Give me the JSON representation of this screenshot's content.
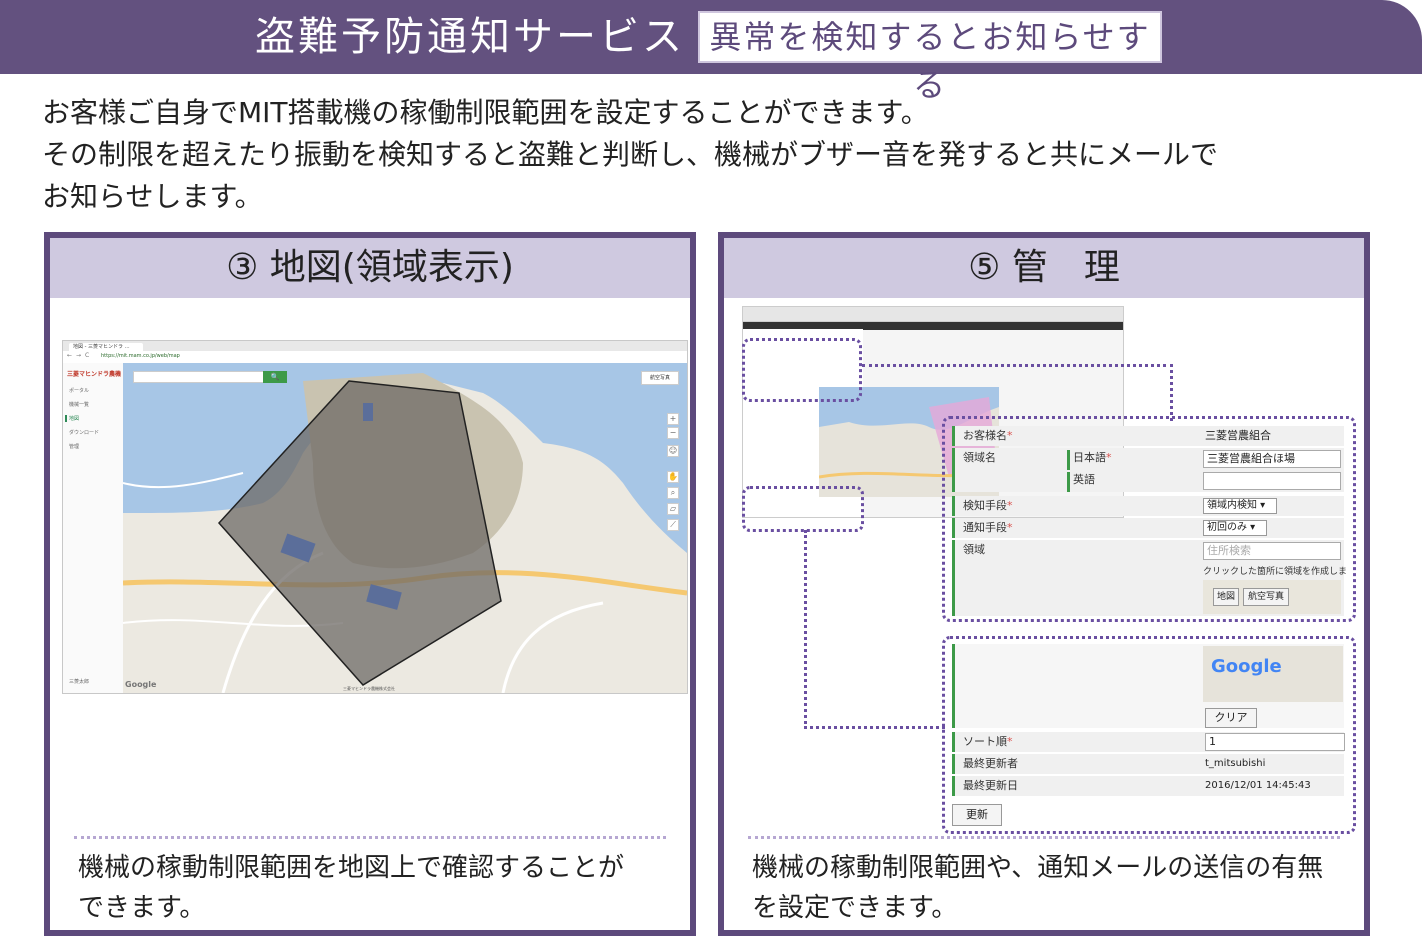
{
  "banner": {
    "title": "盗難予防通知サービス",
    "tag": "異常を検知するとお知らせする"
  },
  "intro": [
    "お客様ご自身でMIT搭載機の稼働制限範囲を設定することができます。",
    "その制限を超えたり振動を検知すると盗難と判断し、機械がブザー音を発すると共にメールで",
    "お知らせします。"
  ],
  "panels": {
    "left": {
      "title": "③ 地図(領域表示)",
      "caption": [
        "機械の稼動制限範囲を地図上で確認することが",
        "できます。"
      ],
      "screenshot": {
        "tab": "地図 - 三菱マヒンドラ …",
        "url": "https://mit.mam.co.jp/web/map",
        "logo": "三菱マヒンドラ農機",
        "sidebar": [
          "ポータル",
          "機械一覧",
          "地図",
          "ダウンロード",
          "管理"
        ],
        "user": "三菱太郎",
        "map_type": "航空写真",
        "google": "Google",
        "copyright": "三菱マヒンドラ農機株式会社"
      }
    },
    "right": {
      "title": "⑤ 管　理",
      "caption": [
        "機械の稼動制限範囲や、通知メールの送信の有無",
        "を設定できます。"
      ],
      "form": {
        "customer_label": "お客様名",
        "customer_value": "三菱営農組合",
        "area_name_label": "領域名",
        "japanese_label": "日本語",
        "japanese_value": "三菱営農組合ほ場",
        "english_label": "英語",
        "english_value": "",
        "detect_label": "検知手段",
        "detect_value": "領域内検知",
        "notify_label": "通知手段",
        "notify_value": "初回のみ",
        "area_label": "領域",
        "address_placeholder": "住所検索",
        "hint": "クリックした箇所に領域を作成しま",
        "map_btn": "地図",
        "aerial_btn": "航空写真",
        "google": "Google",
        "clear_btn": "クリア",
        "sort_label": "ソート順",
        "sort_value": "1",
        "updated_by_label": "最終更新者",
        "updated_by_value": "t_mitsubishi",
        "updated_at_label": "最終更新日",
        "updated_at_value": "2016/12/01 14:45:43",
        "update_btn": "更新"
      }
    }
  },
  "colors": {
    "brand": "#63517f",
    "panel_head": "#cfc9e0",
    "accent_green": "#3d9a48",
    "dotted": "#6a4fa1"
  }
}
